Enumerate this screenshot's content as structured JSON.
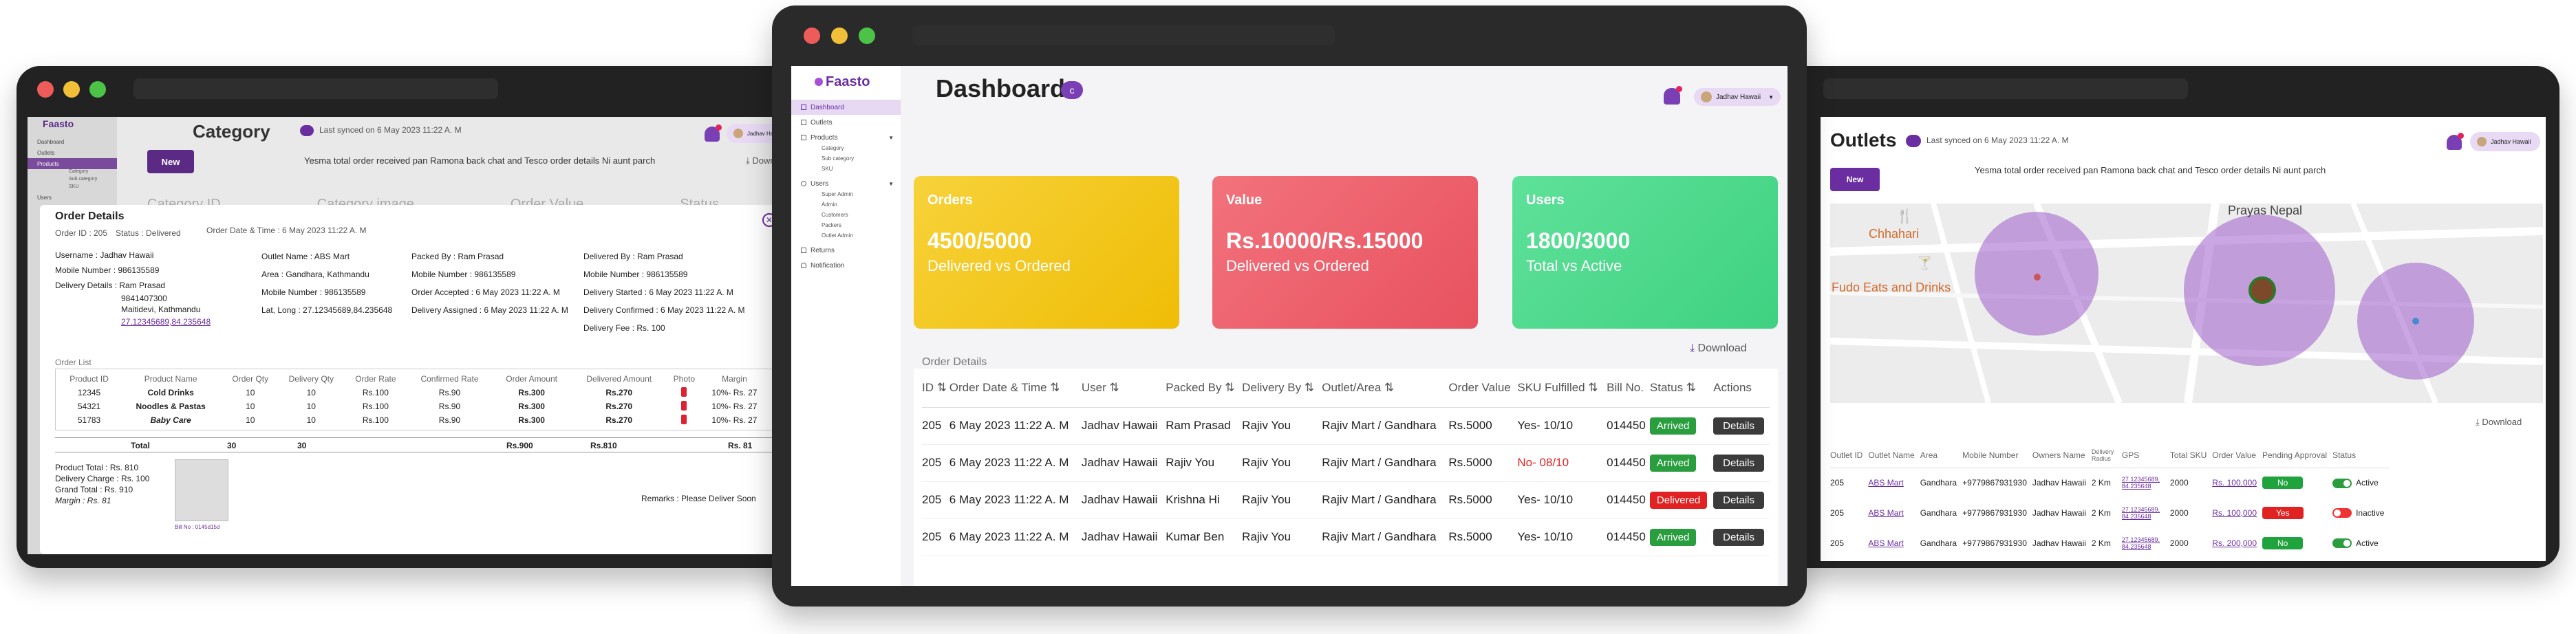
{
  "brand": "Faasto",
  "left": {
    "title": "Category",
    "synced": "Last synced on 6 May 2023 11:22 A. M",
    "new_btn": "New",
    "marquee": "Yesma total order received pan Ramona back chat and Tesco order details Ni aunt parch",
    "download": "Download",
    "user": "Jadhav Hawaii",
    "sidebar": [
      "Dashboard",
      "Outlets",
      "Products",
      "Category",
      "Sub category",
      "SKU",
      "Users"
    ],
    "bg_headers": [
      "Category ID",
      "Category image",
      "Order Value",
      "Status"
    ],
    "modal": {
      "title": "Order Details",
      "order_id": "Order ID : 205",
      "status": "Status : Delivered",
      "order_dt": "Order Date & Time : 6 May 2023 11:22 A. M",
      "col1": [
        "Username : Jadhav Hawaii",
        "Mobile Number : 986135589",
        "Delivery Details : Ram Prasad",
        "9841407300",
        "Maitidevi, Kathmandu",
        "27.12345689,84.235648"
      ],
      "col2": [
        "Outlet Name : ABS Mart",
        "Area : Gandhara, Kathmandu",
        "Mobile Number : 986135589",
        "Lat, Long : 27.12345689,84.235648"
      ],
      "col3": [
        "Packed By : Ram Prasad",
        "Mobile Number : 986135589",
        "Order Accepted : 6 May 2023 11:22 A. M",
        "Delivery Assigned : 6 May 2023 11:22 A. M"
      ],
      "col4": [
        "Delivered By : Ram Prasad",
        "Mobile Number : 986135589",
        "Delivery Started : 6 May 2023 11:22 A. M",
        "Delivery Confirmed : 6 May 2023 11:22 A. M",
        "Delivery Fee : Rs. 100"
      ],
      "list_title": "Order List",
      "headers": [
        "Product ID",
        "Product Name",
        "Order Qty",
        "Delivery Qty",
        "Order Rate",
        "Confirmed Rate",
        "Order Amount",
        "Delivered Amount",
        "Photo",
        "Margin"
      ],
      "rows": [
        [
          "12345",
          "Cold Drinks",
          "10",
          "10",
          "Rs.100",
          "Rs.90",
          "Rs.300",
          "Rs.270",
          "",
          "10%- Rs. 27"
        ],
        [
          "54321",
          "Noodles & Pastas",
          "10",
          "10",
          "Rs.100",
          "Rs.90",
          "Rs.300",
          "Rs.270",
          "",
          "10%- Rs. 27"
        ],
        [
          "51783",
          "Baby Care",
          "10",
          "10",
          "Rs.100",
          "Rs.90",
          "Rs.300",
          "Rs.270",
          "",
          "10%- Rs. 27"
        ]
      ],
      "total": [
        "Total",
        "30",
        "30",
        "Rs.900",
        "Rs.810",
        "Rs. 81"
      ],
      "summary": [
        "Product Total : Rs. 810",
        "Delivery Charge : Rs. 100",
        "Grand Total : Rs. 910",
        "Margin : Rs. 81"
      ],
      "photo_caption": "Bill No : 0145d15d",
      "remarks": "Remarks : Please Deliver Soon"
    }
  },
  "center": {
    "title": "Dashboard",
    "user": "Jadhav Hawaii",
    "sidebar": {
      "items": [
        "Dashboard",
        "Outlets",
        "Products",
        "Users",
        "Returns",
        "Notification"
      ],
      "products_sub": [
        "Category",
        "Sub category",
        "SKU"
      ],
      "users_sub": [
        "Super Admin",
        "Admin",
        "Customers",
        "Packers",
        "Outlet Admin"
      ]
    },
    "cards": [
      {
        "title": "Orders",
        "value": "4500/5000",
        "sub": "Delivered vs Ordered",
        "color": "#f2c614"
      },
      {
        "title": "Value",
        "value": "Rs.10000/Rs.15000",
        "sub": "Delivered vs Ordered",
        "color": "#ee5f6d"
      },
      {
        "title": "Users",
        "value": "1800/3000",
        "sub": "Total vs Active",
        "color": "#4fd98c"
      }
    ],
    "order_details": "Order Details",
    "download": "Download",
    "headers": [
      "ID",
      "Order Date & Time",
      "User",
      "Packed By",
      "Delivery By",
      "Outlet/Area",
      "Order Value",
      "SKU Fulfilled",
      "Bill No.",
      "Status",
      "Actions"
    ],
    "rows": [
      [
        "205",
        "6 May 2023 11:22 A. M",
        "Jadhav Hawaii",
        "Ram Prasad",
        "Rajiv You",
        "Rajiv Mart / Gandhara",
        "Rs.5000",
        "Yes- 10/10",
        "014450",
        "Arrived",
        "Details"
      ],
      [
        "205",
        "6 May 2023 11:22 A. M",
        "Jadhav Hawaii",
        "Rajiv You",
        "Rajiv You",
        "Rajiv Mart / Gandhara",
        "Rs.5000",
        "No- 08/10",
        "014450",
        "Arrived",
        "Details"
      ],
      [
        "205",
        "6 May 2023 11:22 A. M",
        "Jadhav Hawaii",
        "Krishna Hi",
        "Rajiv You",
        "Rajiv Mart / Gandhara",
        "Rs.5000",
        "Yes- 10/10",
        "014450",
        "Delivered",
        "Details"
      ],
      [
        "205",
        "6 May 2023 11:22 A. M",
        "Jadhav Hawaii",
        "Kumar Ben",
        "Rajiv You",
        "Rajiv Mart / Gandhara",
        "Rs.5000",
        "Yes- 10/10",
        "014450",
        "Arrived",
        "Details"
      ]
    ]
  },
  "right": {
    "title": "Outlets",
    "synced": "Last synced on 6 May 2023 11:22 A. M",
    "new_btn": "New",
    "marquee": "Yesma total order received pan Ramona back chat and Tesco order details Ni aunt parch",
    "user": "Jadhav Hawaii",
    "map_labels": [
      "Chhahari",
      "Fudo Eats and Drinks",
      "Prayas Nepal"
    ],
    "download": "Download",
    "headers": [
      "Outlet ID",
      "Outlet Name",
      "Area",
      "Mobile Number",
      "Owners Name",
      "Delivery Radius",
      "GPS",
      "Total SKU",
      "Order Value",
      "Pending Approval",
      "Status"
    ],
    "rows": [
      [
        "205",
        "ABS Mart",
        "Gandhara",
        "+9779867931930",
        "Jadhav Hawaii",
        "2 Km",
        "27.12345689, 84.235648",
        "2000",
        "Rs. 100,000",
        "No",
        "Active"
      ],
      [
        "205",
        "ABS Mart",
        "Gandhara",
        "+9779867931930",
        "Jadhav Hawaii",
        "2 Km",
        "27.12345689, 84.235648",
        "2000",
        "Rs. 100,000",
        "Yes",
        "Inactive"
      ],
      [
        "205",
        "ABS Mart",
        "Gandhara",
        "+9779867931930",
        "Jadhav Hawaii",
        "2 Km",
        "27.12345689, 84.235648",
        "2000",
        "Rs. 200,000",
        "No",
        "Active"
      ]
    ]
  }
}
